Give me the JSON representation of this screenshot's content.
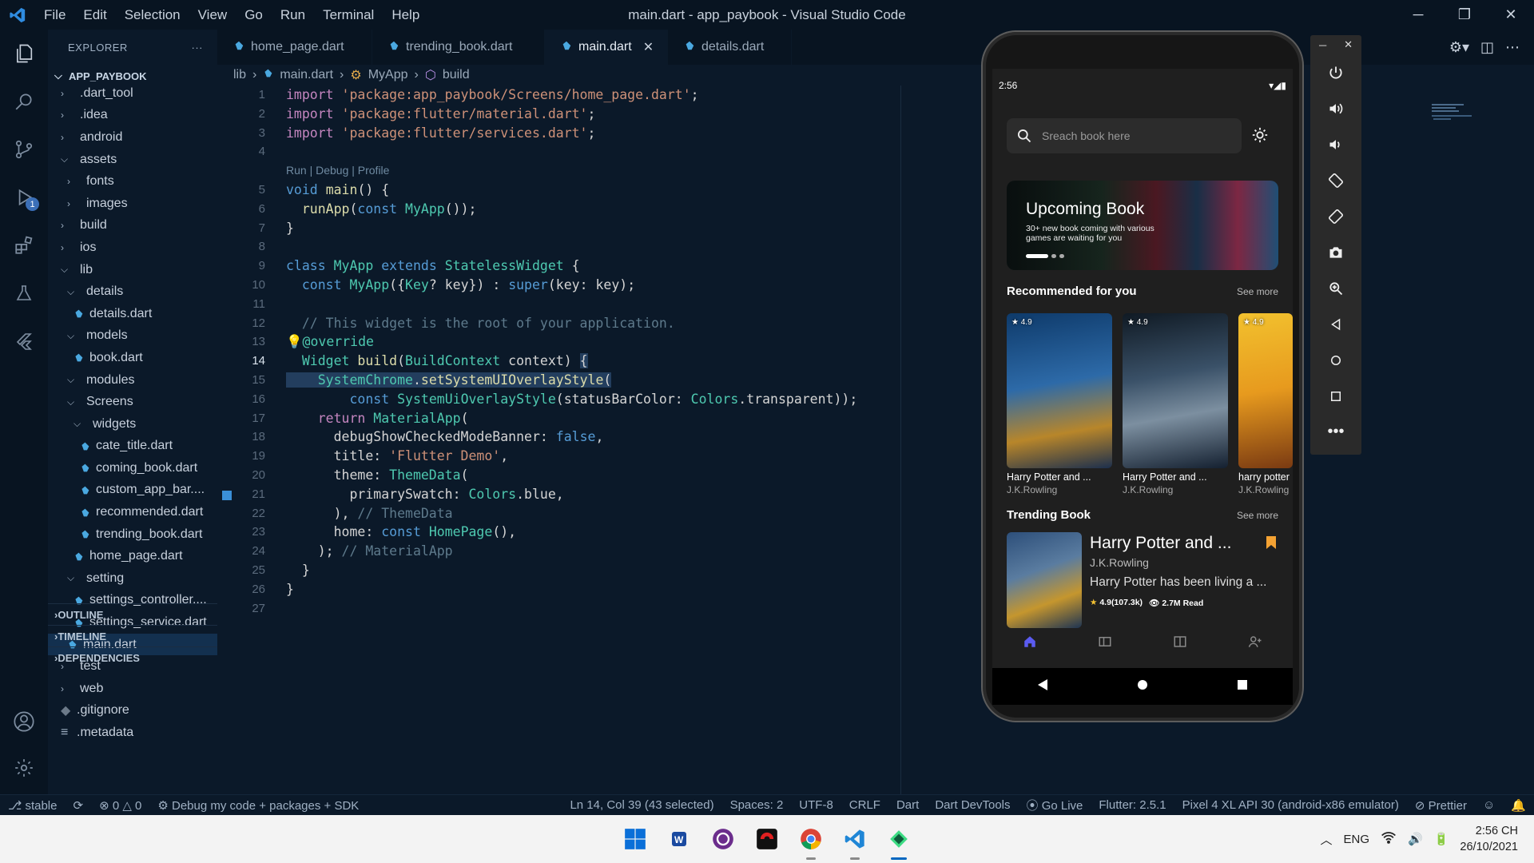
{
  "window": {
    "title": "main.dart - app_paybook - Visual Studio Code",
    "menu": [
      "File",
      "Edit",
      "Selection",
      "View",
      "Go",
      "Run",
      "Terminal",
      "Help"
    ]
  },
  "activity_bar": {
    "debug_badge": "1"
  },
  "sidebar": {
    "header": "EXPLORER",
    "more": "···",
    "root": "APP_PAYBOOK",
    "items": [
      {
        "label": ".dart_tool",
        "kind": "folder",
        "depth": 1,
        "open": false
      },
      {
        "label": ".idea",
        "kind": "folder",
        "depth": 1,
        "open": false
      },
      {
        "label": "android",
        "kind": "folder",
        "depth": 1,
        "open": false
      },
      {
        "label": "assets",
        "kind": "folder",
        "depth": 1,
        "open": true
      },
      {
        "label": "fonts",
        "kind": "folder",
        "depth": 2,
        "open": false
      },
      {
        "label": "images",
        "kind": "folder",
        "depth": 2,
        "open": false
      },
      {
        "label": "build",
        "kind": "folder",
        "depth": 1,
        "open": false
      },
      {
        "label": "ios",
        "kind": "folder",
        "depth": 1,
        "open": false
      },
      {
        "label": "lib",
        "kind": "folder",
        "depth": 1,
        "open": true
      },
      {
        "label": "details",
        "kind": "folder",
        "depth": 2,
        "open": true
      },
      {
        "label": "details.dart",
        "kind": "dart",
        "depth": 3
      },
      {
        "label": "models",
        "kind": "folder",
        "depth": 2,
        "open": true
      },
      {
        "label": "book.dart",
        "kind": "dart",
        "depth": 3
      },
      {
        "label": "modules",
        "kind": "folder",
        "depth": 2,
        "open": true
      },
      {
        "label": "Screens",
        "kind": "folder",
        "depth": 2,
        "open": true
      },
      {
        "label": "widgets",
        "kind": "folder",
        "depth": 3,
        "open": true
      },
      {
        "label": "cate_title.dart",
        "kind": "dart",
        "depth": 4
      },
      {
        "label": "coming_book.dart",
        "kind": "dart",
        "depth": 4
      },
      {
        "label": "custom_app_bar....",
        "kind": "dart",
        "depth": 4
      },
      {
        "label": "recommended.dart",
        "kind": "dart",
        "depth": 4
      },
      {
        "label": "trending_book.dart",
        "kind": "dart",
        "depth": 4
      },
      {
        "label": "home_page.dart",
        "kind": "dart",
        "depth": 3
      },
      {
        "label": "setting",
        "kind": "folder",
        "depth": 2,
        "open": true
      },
      {
        "label": "settings_controller....",
        "kind": "dart",
        "depth": 3
      },
      {
        "label": "settings_service.dart",
        "kind": "dart",
        "depth": 3
      },
      {
        "label": "main.dart",
        "kind": "dart",
        "depth": 2,
        "selected": true
      },
      {
        "label": "test",
        "kind": "folder",
        "depth": 1,
        "open": false
      },
      {
        "label": "web",
        "kind": "folder",
        "depth": 1,
        "open": false
      },
      {
        "label": ".gitignore",
        "kind": "git",
        "depth": 1
      },
      {
        "label": ".metadata",
        "kind": "text",
        "depth": 1
      }
    ],
    "sections": [
      "OUTLINE",
      "TIMELINE",
      "DEPENDENCIES"
    ]
  },
  "tabs": [
    {
      "label": "home_page.dart",
      "active": false
    },
    {
      "label": "trending_book.dart",
      "active": false
    },
    {
      "label": "main.dart",
      "active": true
    },
    {
      "label": "details.dart",
      "active": false
    }
  ],
  "breadcrumb": [
    "lib",
    "main.dart",
    "MyApp",
    "build"
  ],
  "editor": {
    "codelens": "Run | Debug | Profile",
    "line_numbers": [
      "1",
      "2",
      "3",
      "4",
      "5",
      "6",
      "7",
      "8",
      "9",
      "10",
      "11",
      "12",
      "13",
      "14",
      "15",
      "16",
      "17",
      "18",
      "19",
      "20",
      "21",
      "22",
      "23",
      "24",
      "25",
      "26",
      "27"
    ],
    "current_line": "14"
  },
  "status_bar": {
    "branch": "stable",
    "problems": "0",
    "warnings": "0",
    "debug": "Debug my code + packages + SDK",
    "position": "Ln 14, Col 39 (43 selected)",
    "spaces": "Spaces: 2",
    "encoding": "UTF-8",
    "eol": "CRLF",
    "language": "Dart",
    "devtools": "Dart DevTools",
    "golive": "Go Live",
    "flutter": "Flutter: 2.5.1",
    "device": "Pixel 4 XL API 30 (android-x86 emulator)",
    "prettier": "Prettier"
  },
  "emulator": {
    "time": "2:56",
    "search_placeholder": "Sreach book here",
    "banner_title": "Upcoming Book",
    "banner_sub": "30+ new book coming with various games are waiting for you",
    "recommended_heading": "Recommended for you",
    "see_more": "See more",
    "books": [
      {
        "title": "Harry Potter and ...",
        "author": "J.K.Rowling",
        "rating": "4.9"
      },
      {
        "title": "Harry Potter and ...",
        "author": "J.K.Rowling",
        "rating": "4.9"
      },
      {
        "title": "harry potter",
        "author": "J.K.Rowling",
        "rating": "4.9"
      }
    ],
    "trending_heading": "Trending Book",
    "trending": {
      "title": "Harry Potter and ...",
      "author": "J.K.Rowling",
      "desc": "Harry Potter has been living a ...",
      "rating": "4.9(107.3k)",
      "reads": "2.7M Read"
    }
  },
  "taskbar": {
    "lang": "ENG",
    "time": "2:56 CH",
    "date": "26/10/2021"
  },
  "colors": {
    "accent": "#3a8fd8",
    "bookmark": "#f4a233",
    "nav_active": "#5b5bf0"
  }
}
